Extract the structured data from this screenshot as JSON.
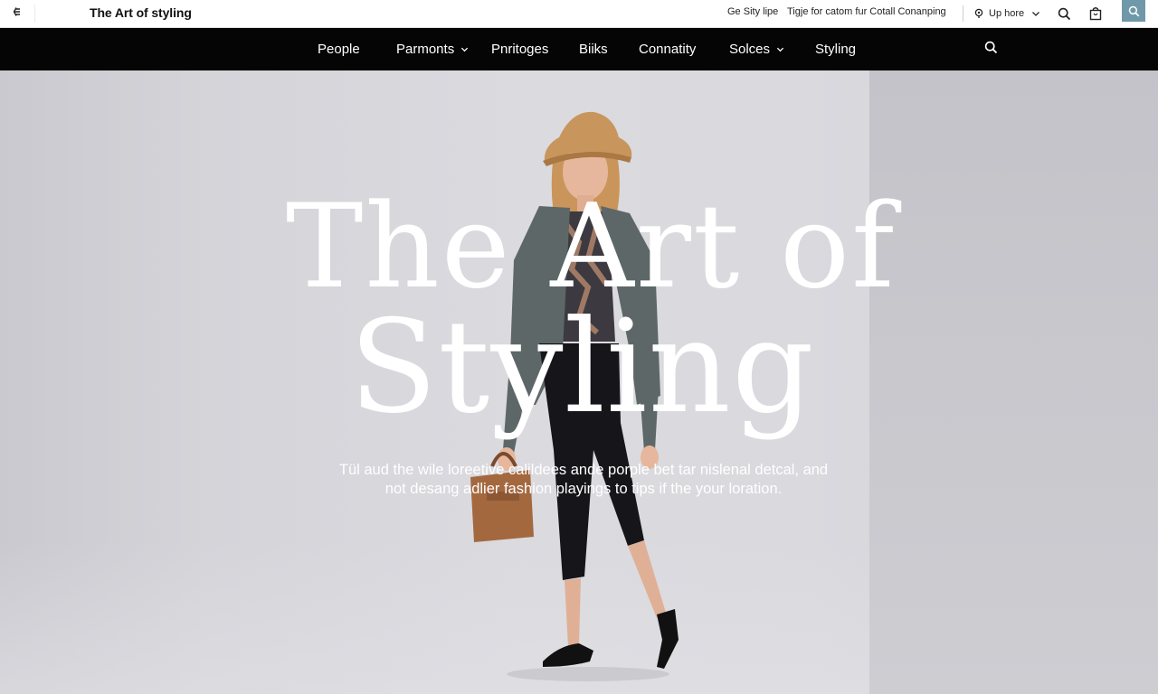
{
  "topbar": {
    "site_title": "The Art of styling",
    "link_1": "Ge Sity lipe",
    "link_2": "Tigje for catom fur Cotall Conanping",
    "location_label": "Up hore"
  },
  "nav": {
    "items": [
      {
        "label": "People"
      },
      {
        "label": "Parmonts"
      },
      {
        "label": "Pnritoges"
      },
      {
        "label": "Biiks"
      },
      {
        "label": "Connatity"
      },
      {
        "label": "Solces"
      },
      {
        "label": "Styling"
      }
    ]
  },
  "hero": {
    "headline_line1": "The Art of",
    "headline_line2": "Styling",
    "subtext_line1": "Tül aud the wile loreetive calildees ande porple bet tar nislenal detcal, and",
    "subtext_line2": "not desang adlier fashion playings to tips if the your loration."
  },
  "colors": {
    "nav_background": "#050505",
    "search_button": "#6f99a8",
    "hero_text": "#ffffff"
  },
  "icons": [
    "back-arrow-icon",
    "location-pin-icon",
    "chevron-down-icon",
    "search-icon",
    "bag-icon"
  ]
}
